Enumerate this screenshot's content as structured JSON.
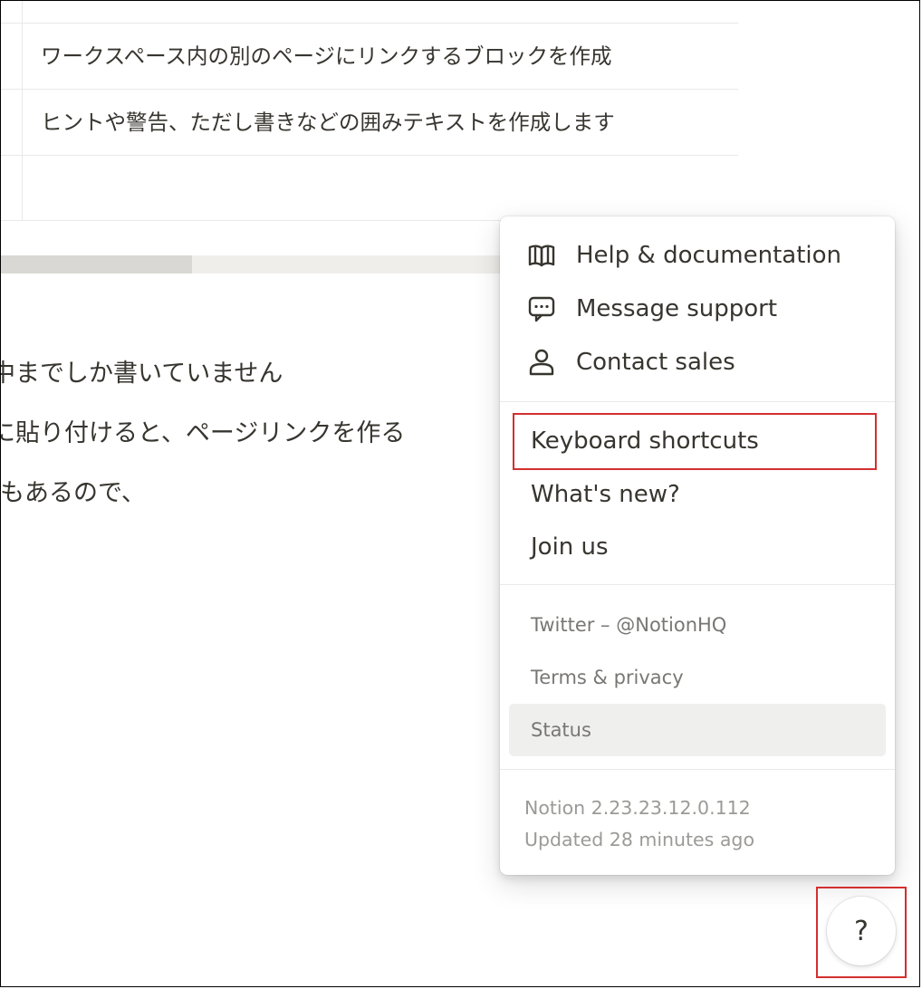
{
  "page": {
    "table_rows": [
      "ワークスペース内の別のページにリンクするブロックを作成",
      "ヒントや警告、ただし書きなどの囲みテキストを作成します"
    ],
    "body_lines": [
      "中までしか書いていません",
      "に貼り付けると、ページリンクを作る",
      "もあるので、"
    ]
  },
  "help_menu": {
    "primary": [
      {
        "label": "Help & documentation",
        "icon": "book-icon"
      },
      {
        "label": "Message support",
        "icon": "chat-bubble-icon"
      },
      {
        "label": "Contact sales",
        "icon": "person-icon"
      }
    ],
    "secondary": [
      {
        "label": "Keyboard shortcuts"
      },
      {
        "label": "What's new?"
      },
      {
        "label": "Join us"
      }
    ],
    "links": [
      {
        "label": "Twitter – @NotionHQ"
      },
      {
        "label": "Terms & privacy"
      },
      {
        "label": "Status"
      }
    ],
    "version": "Notion 2.23.23.12.0.112",
    "updated": "Updated 28 minutes ago"
  },
  "help_button": {
    "label": "?"
  },
  "colors": {
    "highlight": "#d32f2f",
    "hover_bg": "#efefee",
    "text": "#37352f",
    "muted": "#787774"
  }
}
